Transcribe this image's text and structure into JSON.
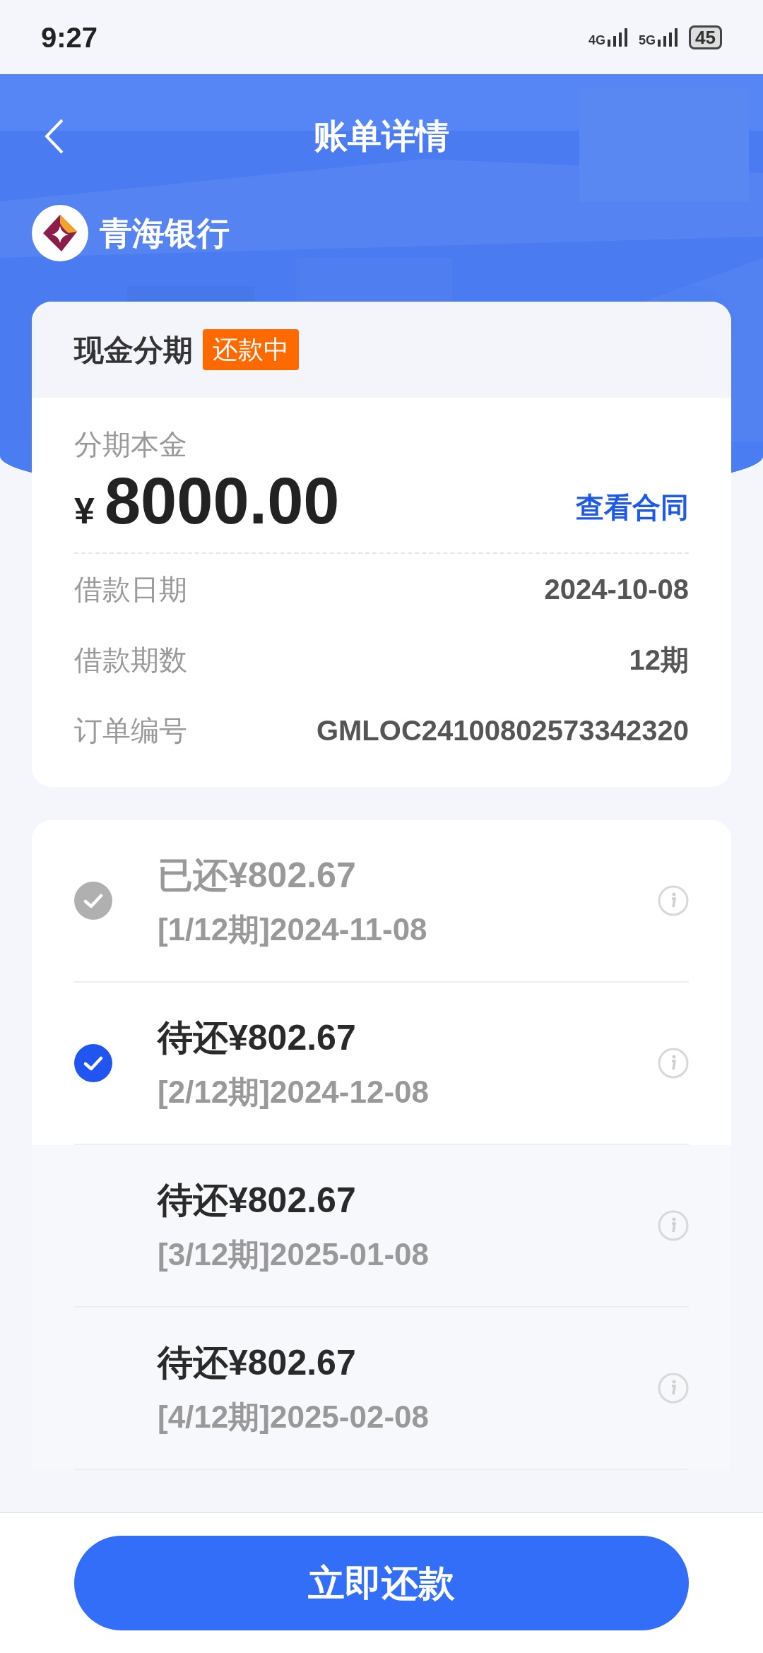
{
  "status_bar": {
    "time": "9:27",
    "network_1": "4G",
    "network_2": "5G",
    "battery": "45"
  },
  "header": {
    "title": "账单详情"
  },
  "bank": {
    "name": "青海银行"
  },
  "loan": {
    "type": "现金分期",
    "status": "还款中",
    "principal_label": "分期本金",
    "currency": "¥",
    "principal": "8000.00",
    "contract_link": "查看合同",
    "details": [
      {
        "label": "借款日期",
        "value": "2024-10-08"
      },
      {
        "label": "借款期数",
        "value": "12期"
      },
      {
        "label": "订单编号",
        "value": "GMLOC24100802573342320"
      }
    ]
  },
  "installments": [
    {
      "status": "已还",
      "amount": "¥802.67",
      "period": "[1/12期]2024-11-08",
      "paid": true,
      "selected": false
    },
    {
      "status": "待还",
      "amount": "¥802.67",
      "period": "[2/12期]2024-12-08",
      "paid": false,
      "selected": true
    },
    {
      "status": "待还",
      "amount": "¥802.67",
      "period": "[3/12期]2025-01-08",
      "paid": false,
      "selected": false
    },
    {
      "status": "待还",
      "amount": "¥802.67",
      "period": "[4/12期]2025-02-08",
      "paid": false,
      "selected": false
    }
  ],
  "action": {
    "label": "立即还款"
  }
}
